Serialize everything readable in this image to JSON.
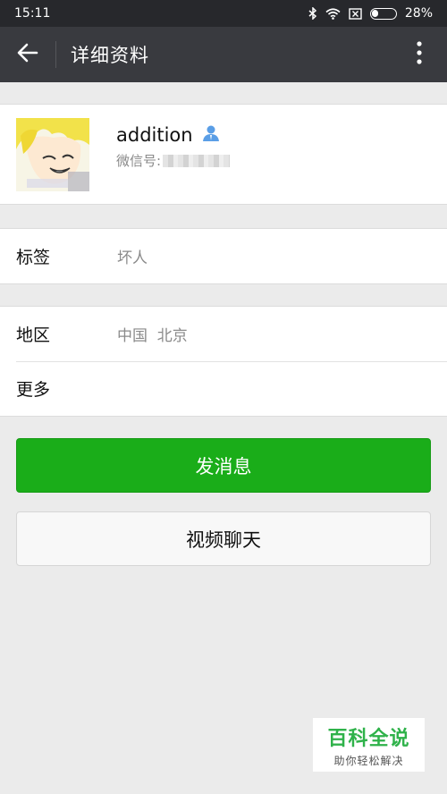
{
  "status_bar": {
    "time": "15:11",
    "battery_percent": "28%",
    "battery_level": 0.28,
    "icons": [
      "bluetooth-icon",
      "wifi-icon",
      "sim-off-icon",
      "battery-icon"
    ]
  },
  "header": {
    "title": "详细资料"
  },
  "profile": {
    "name": "addition",
    "wechat_id_label": "微信号:",
    "gender_icon": "user-icon",
    "gender_color": "#5a9ee6"
  },
  "tags": {
    "label": "标签",
    "value": "坏人"
  },
  "info": {
    "region_label": "地区",
    "region_value": "中国  北京",
    "more_label": "更多"
  },
  "actions": {
    "send_message": "发消息",
    "video_chat": "视频聊天"
  },
  "watermark": {
    "title": "百科全说",
    "subtitle": "助你轻松解决"
  },
  "colors": {
    "primary_green": "#1aad19",
    "header_bg": "#393a3f",
    "status_bg": "#27282c"
  }
}
